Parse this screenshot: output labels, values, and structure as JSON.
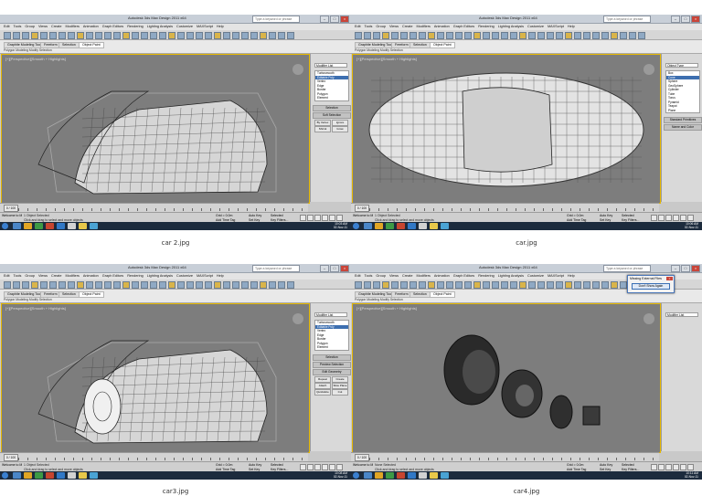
{
  "app": {
    "title": "Autodesk 3ds Max Design 2011 x64",
    "search_placeholder": "Type a keyword or phrase",
    "menus": [
      "Edit",
      "Tools",
      "Group",
      "Views",
      "Create",
      "Modifiers",
      "Animation",
      "Graph Editors",
      "Rendering",
      "Lighting Analysis",
      "Customize",
      "MAXScript",
      "Help"
    ],
    "ribbon_tabs": [
      "Graphite Modeling Tools",
      "Freeform",
      "Selection",
      "Object Paint"
    ],
    "ribbon_sub": [
      "Polygon Modeling",
      "Modify Selection"
    ],
    "viewport_label": "[+][Perspective][Smooth + Highlights]",
    "time_slider": "0 / 100",
    "grid_label": "Grid = 0.0m",
    "key_label": "Auto Key",
    "set_key_label": "Set Key",
    "selected_label": "Selected",
    "key_filters_label": "Key Filters...",
    "add_time_tag": "Add Time Tag",
    "welcome": "Welcome to M"
  },
  "panels": [
    {
      "caption": "car 2.jpg",
      "status_line1": "1 Object Selected",
      "status_line2": "Click and drag to select and move objects",
      "clock_time": "10:03 AM",
      "clock_date": "02-Nov-11",
      "modifier": "Modifier List",
      "stack": [
        "Turbosmooth",
        "Editable Poly",
        "Vertex",
        "Edge",
        "Border",
        "Polygon",
        "Element"
      ],
      "rollouts": [
        "Selection",
        "Soft Selection"
      ],
      "options": [
        "By Vertex",
        "Ignore Backfacing",
        "Shrink",
        "Grow"
      ]
    },
    {
      "caption": "car.jpg",
      "status_line1": "1 Object Selected",
      "status_line2": "Click and drag to select and move objects",
      "clock_time": "10:06 AM",
      "clock_date": "02-Nov-11",
      "modifier": "Object Type",
      "stack": [
        "Box",
        "Cone",
        "Sphere",
        "GeoSphere",
        "Cylinder",
        "Tube",
        "Torus",
        "Pyramid",
        "Teapot",
        "Plane"
      ],
      "rollouts": [
        "Standard Primitives",
        "Name and Color"
      ],
      "options": []
    },
    {
      "caption": "car3.jpg",
      "status_line1": "1 Object Selected",
      "status_line2": "Click and drag to select and move objects",
      "clock_time": "10:08 AM",
      "clock_date": "02-Nov-11",
      "modifier": "Modifier List",
      "stack": [
        "Turbosmooth",
        "Editable Poly",
        "Vertex",
        "Edge",
        "Border",
        "Polygon",
        "Element"
      ],
      "rollouts": [
        "Selection",
        "Preview Selection",
        "Edit Geometry"
      ],
      "options": [
        "Repeat Last",
        "Create",
        "Attach",
        "Slice Plane",
        "Quickslice",
        "Cut"
      ]
    },
    {
      "caption": "car4.jpg",
      "status_line1": "None Selected",
      "status_line2": "Click and drag to select and move objects",
      "clock_time": "10:11 AM",
      "clock_date": "02-Nov-11",
      "modifier": "Modifier List",
      "stack": [],
      "rollouts": [],
      "options": [],
      "dialog": {
        "title": "Missing External Files",
        "button": "Don't Show Again"
      }
    }
  ],
  "colors": {
    "viewport_bg": "#7d7d7d",
    "selection_border": "#e6b800",
    "taskbar": "#1c2b3d",
    "accent": "#3d6fb0"
  }
}
